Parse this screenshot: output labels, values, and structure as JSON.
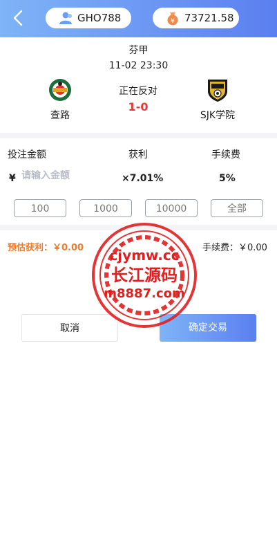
{
  "header": {
    "username": "GHO788",
    "balance": "73721.58",
    "icons": {
      "back": "back-arrow-icon",
      "user": "user-icon",
      "balance": "money-bag-icon"
    },
    "colors": {
      "gradient_start": "#7fb4f7",
      "gradient_end": "#5b7ff0"
    }
  },
  "match": {
    "league": "芬甲",
    "datetime": "11-02 23:30",
    "status": "正在反对",
    "score": "1-0",
    "home_team": "查路",
    "away_team": "SJK学院"
  },
  "bet": {
    "amount_label": "投注金额",
    "profit_label": "获利",
    "fee_label": "手续费",
    "currency_symbol": "¥",
    "amount_placeholder": "请输入金额",
    "profit_rate": "×7.01%",
    "fee_rate": "5%",
    "quick_amounts": [
      "100",
      "1000",
      "10000",
      "全部"
    ]
  },
  "summary": {
    "estimated_profit": "预估获利：￥0.00",
    "fee": "手续费：￥0.00"
  },
  "actions": {
    "cancel": "取消",
    "confirm": "确定交易"
  },
  "watermark": {
    "line1": "cjymw.cc",
    "line2": "长江源码",
    "line3": "m8887.com",
    "color": "#e02020"
  }
}
